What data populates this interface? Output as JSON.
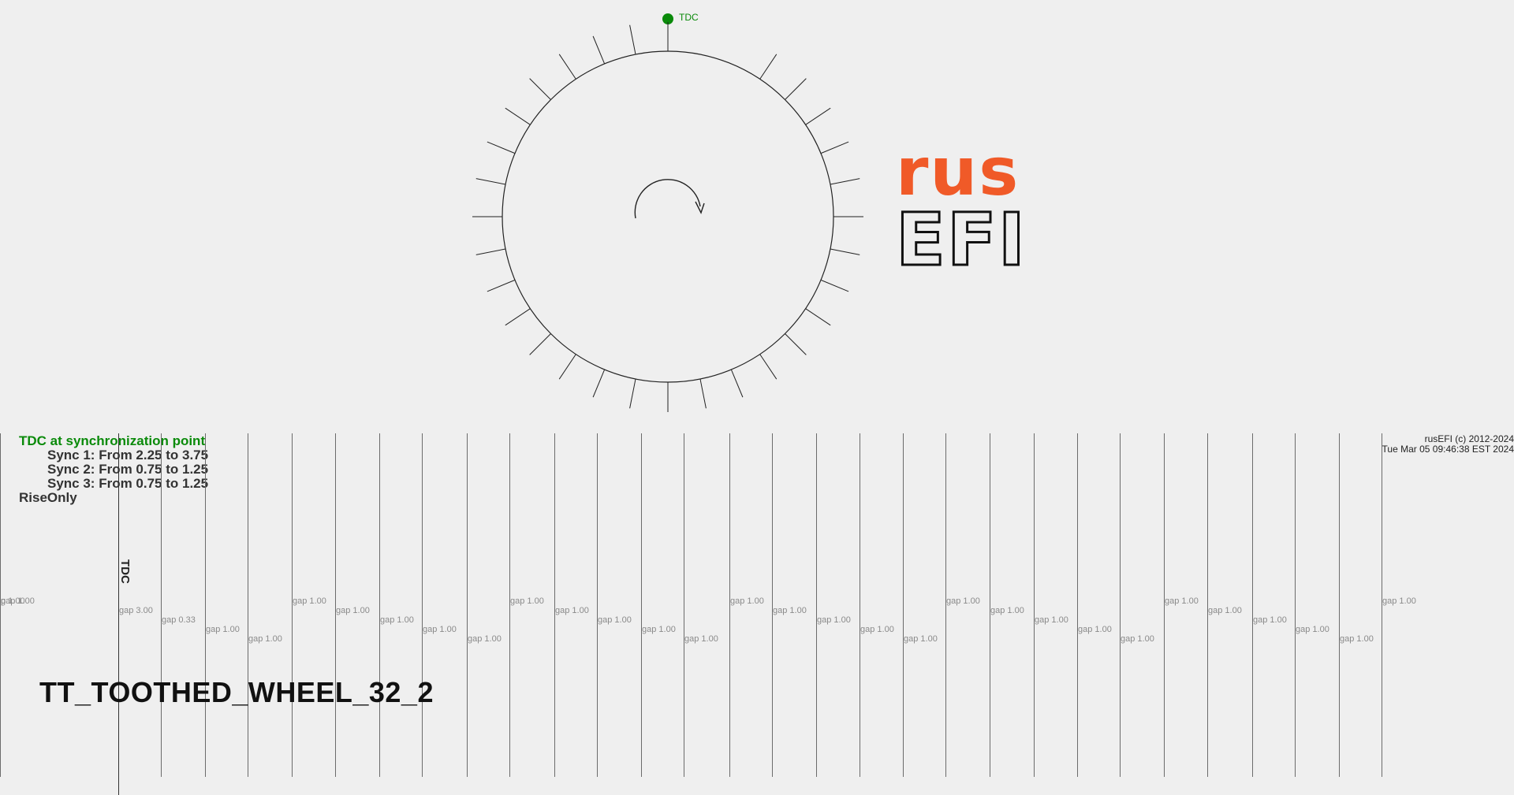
{
  "wheel": {
    "tdc_label": "TDC",
    "total_teeth": 32,
    "missing_teeth": 2
  },
  "logo": {
    "top_text": "rus",
    "bottom_text": "EFI",
    "accent_color": "#f05a28"
  },
  "info": {
    "sync_title": "TDC at synchronization point",
    "sync_lines": [
      "Sync 1: From 2.25 to 3.75",
      "Sync 2: From 0.75 to 1.25",
      "Sync 3: From 0.75 to 1.25"
    ],
    "mode": "RiseOnly"
  },
  "copyright": {
    "line1": "rusEFI (c) 2012-2024",
    "line2": "Tue Mar 05 09:46:38 EST 2024"
  },
  "trigger_name": "TT_TOOTHED_WHEEL_32_2",
  "tdc_vertical_label": "TDC",
  "gaps": [
    {
      "label": "p 1.00"
    },
    {
      "label": "gap 3.00"
    },
    {
      "label": "gap 0.33"
    },
    {
      "label": "gap 1.00"
    },
    {
      "label": "gap 1.00"
    },
    {
      "label": "gap 1.00"
    },
    {
      "label": "gap 1.00"
    },
    {
      "label": "gap 1.00"
    },
    {
      "label": "gap 1.00"
    },
    {
      "label": "gap 1.00"
    },
    {
      "label": "gap 1.00"
    },
    {
      "label": "gap 1.00"
    },
    {
      "label": "gap 1.00"
    },
    {
      "label": "gap 1.00"
    },
    {
      "label": "gap 1.00"
    },
    {
      "label": "gap 1.00"
    },
    {
      "label": "gap 1.00"
    },
    {
      "label": "gap 1.00"
    },
    {
      "label": "gap 1.00"
    },
    {
      "label": "gap 1.00"
    },
    {
      "label": "gap 1.00"
    },
    {
      "label": "gap 1.00"
    },
    {
      "label": "gap 1.00"
    },
    {
      "label": "gap 1.00"
    },
    {
      "label": "gap 1.00"
    },
    {
      "label": "gap 1.00"
    },
    {
      "label": "gap 1.00"
    },
    {
      "label": "gap 1.00"
    },
    {
      "label": "gap 1.00"
    },
    {
      "label": "gap 1.00"
    },
    {
      "label": "gap 1.00"
    },
    {
      "label": "gap 1.00"
    }
  ],
  "colors": {
    "tdc": "#0a8a0a",
    "line": "#6b6b6b",
    "text": "#333333"
  }
}
